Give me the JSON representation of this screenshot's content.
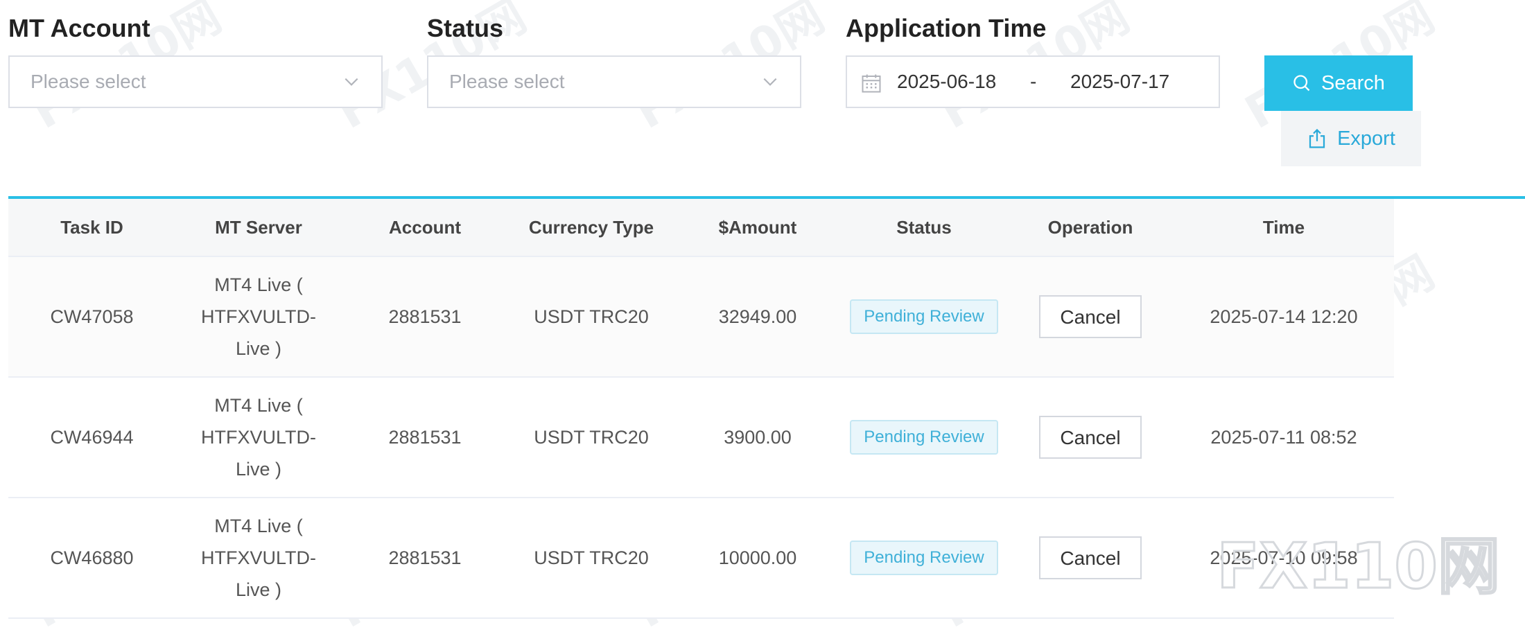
{
  "filters": {
    "mt_account": {
      "label": "MT Account",
      "placeholder": "Please select"
    },
    "status": {
      "label": "Status",
      "placeholder": "Please select"
    },
    "application_time": {
      "label": "Application Time",
      "start": "2025-06-18",
      "separator": "-",
      "end": "2025-07-17"
    }
  },
  "actions": {
    "search_label": "Search",
    "export_label": "Export"
  },
  "table": {
    "headers": [
      "Task ID",
      "MT Server",
      "Account",
      "Currency Type",
      "$Amount",
      "Status",
      "Operation",
      "Time"
    ],
    "rows": [
      {
        "task_id": "CW47058",
        "server": "MT4 Live ( HTFXVULTD-Live )",
        "account": "2881531",
        "currency": "USDT TRC20",
        "amount": "32949.00",
        "status": "Pending Review",
        "operation": "Cancel",
        "time": "2025-07-14 12:20"
      },
      {
        "task_id": "CW46944",
        "server": "MT4 Live ( HTFXVULTD-Live )",
        "account": "2881531",
        "currency": "USDT TRC20",
        "amount": "3900.00",
        "status": "Pending Review",
        "operation": "Cancel",
        "time": "2025-07-11 08:52"
      },
      {
        "task_id": "CW46880",
        "server": "MT4 Live ( HTFXVULTD-Live )",
        "account": "2881531",
        "currency": "USDT TRC20",
        "amount": "10000.00",
        "status": "Pending Review",
        "operation": "Cancel",
        "time": "2025-07-10 09:58"
      }
    ]
  },
  "watermark": {
    "text": "FX110网"
  },
  "colors": {
    "accent": "#29bfe6",
    "badge_text": "#3fb0d8",
    "badge_bg": "#e9f6fb"
  },
  "icons": {
    "select": "chevron-down-icon",
    "date": "calendar-icon",
    "search": "search-icon",
    "export": "export-icon"
  }
}
